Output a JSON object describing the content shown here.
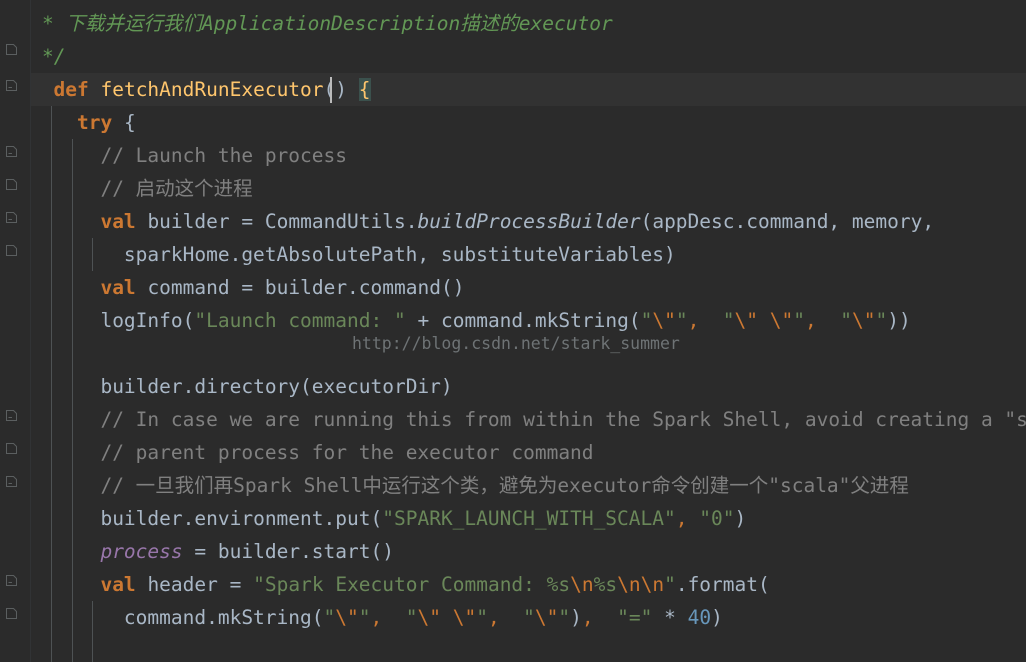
{
  "editor": {
    "theme": "darcula",
    "language": "scala",
    "background_color": "#2b2b2b",
    "current_line_color": "#323232",
    "default_text_color": "#a9b7c6",
    "font_size_px": 19.5,
    "line_height_px": 33
  },
  "watermark": {
    "text": "http://blog.csdn.net/stark_summer",
    "color": "#6e7375"
  },
  "colors": {
    "keyword": "#cc7832",
    "method_declaration": "#ffc66d",
    "string": "#6a8759",
    "escape_sequence": "#cc7832",
    "number": "#6897bb",
    "comment": "#808080",
    "doc_comment": "#629755",
    "field": "#9876aa",
    "identifier": "#a9b7c6",
    "brace_match_background": "#3b514d",
    "indent_guide": "#4e5254",
    "gutter_icon": "#6e7375",
    "caret": "#bbbbbb"
  },
  "gutter": {
    "icon_name": "code-fold-comment-icon",
    "icon_rows": [
      1,
      2,
      4,
      5,
      6,
      7,
      11,
      12,
      13,
      15,
      16
    ]
  },
  "code_lines": [
    {
      "n": 1,
      "indent": 0,
      "text": "   * 下载并运行我们ApplicationDescription描述的executor"
    },
    {
      "n": 2,
      "indent": 0,
      "text": "   */"
    },
    {
      "n": 3,
      "indent": 0,
      "text": "  def fetchAndRunExecutor() {",
      "current": true
    },
    {
      "n": 4,
      "indent": 0,
      "text": "    try {"
    },
    {
      "n": 5,
      "indent": 1,
      "text": "      // Launch the process"
    },
    {
      "n": 6,
      "indent": 1,
      "text": "      // 启动这个进程"
    },
    {
      "n": 7,
      "indent": 1,
      "text": "      val builder = CommandUtils.buildProcessBuilder(appDesc.command, memory,"
    },
    {
      "n": 8,
      "indent": 2,
      "text": "        sparkHome.getAbsolutePath, substituteVariables)"
    },
    {
      "n": 9,
      "indent": 1,
      "text": "      val command = builder.command()"
    },
    {
      "n": 10,
      "indent": 1,
      "text": "      logInfo(\"Launch command: \" + command.mkString(\"\\\"\", \"\\\" \\\"\", \"\\\"\"))"
    },
    {
      "n": 11,
      "indent": 1,
      "text": ""
    },
    {
      "n": 12,
      "indent": 1,
      "text": "      builder.directory(executorDir)"
    },
    {
      "n": 13,
      "indent": 1,
      "text": "      // In case we are running this from within the Spark Shell, avoid creating a \"scala\""
    },
    {
      "n": 14,
      "indent": 1,
      "text": "      // parent process for the executor command"
    },
    {
      "n": 15,
      "indent": 1,
      "text": "      // 一旦我们再Spark Shell中运行这个类，避免为executor命令创建一个\"scala\"父进程"
    },
    {
      "n": 16,
      "indent": 1,
      "text": "      builder.environment.put(\"SPARK_LAUNCH_WITH_SCALA\", \"0\")"
    },
    {
      "n": 17,
      "indent": 1,
      "text": "      process = builder.start()"
    },
    {
      "n": 18,
      "indent": 1,
      "text": "      val header = \"Spark Executor Command: %s\\n%s\\n\\n\".format("
    },
    {
      "n": 19,
      "indent": 2,
      "text": "        command.mkString(\"\\\"\", \"\\\" \\\"\", \"\\\"\"), \"=\" * 40)"
    }
  ],
  "tokens": {
    "line1": {
      "doc_comment": "* 下载并运行我们ApplicationDescription描述的executor"
    },
    "line2": {
      "doc_comment": "*/"
    },
    "line3": {
      "keyword": "def",
      "method_name": "fetchAndRunExecutor",
      "parens": "()",
      "brace": "{"
    },
    "line4": {
      "keyword": "try",
      "brace": "{"
    },
    "line5": {
      "comment": "// Launch the process"
    },
    "line6": {
      "comment": "// 启动这个进程"
    },
    "line7": {
      "keyword": "val",
      "name": "builder",
      "op": "=",
      "object": "CommandUtils",
      "static_method": "buildProcessBuilder",
      "args": "appDesc.command, memory,"
    },
    "line8": {
      "args": "sparkHome.getAbsolutePath, substituteVariables)"
    },
    "line9": {
      "keyword": "val",
      "name": "command",
      "op": "=",
      "expr": "builder.command()"
    },
    "line10": {
      "call": "logInfo",
      "string1": "Launch command: ",
      "op": "+",
      "expr": "command.mkString",
      "arg1": "\\\"",
      "arg2": "\\\" \\\"",
      "arg3": "\\\""
    },
    "line12": {
      "expr": "builder.directory(executorDir)"
    },
    "line13": {
      "comment": "// In case we are running this from within the Spark Shell, avoid creating a \"scala\""
    },
    "line14": {
      "comment": "// parent process for the executor command"
    },
    "line15": {
      "comment": "// 一旦我们再Spark Shell中运行这个类，避免为executor命令创建一个\"scala\"父进程"
    },
    "line16": {
      "expr": "builder.environment.put",
      "arg1": "SPARK_LAUNCH_WITH_SCALA",
      "arg2": "0"
    },
    "line17": {
      "field": "process",
      "op": "=",
      "expr": "builder.start()"
    },
    "line18": {
      "keyword": "val",
      "name": "header",
      "op": "=",
      "string": "Spark Executor Command: %s\\n%s\\n\\n",
      "method": ".format("
    },
    "line19": {
      "expr": "command.mkString",
      "arg1": "\\\"",
      "arg2": "\\\" \\\"",
      "arg3": "\\\"",
      "sep_string": "=",
      "op": "*",
      "number": "40"
    }
  }
}
